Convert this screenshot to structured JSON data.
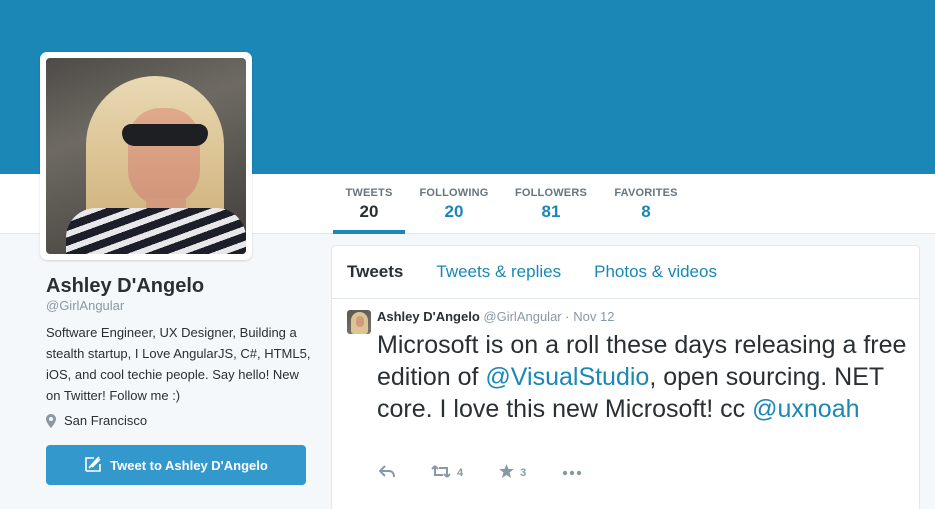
{
  "profile": {
    "name": "Ashley D'Angelo",
    "handle": "@GirlAngular",
    "bio": "Software Engineer, UX Designer, Building a stealth startup, I Love AngularJS, C#, HTML5, iOS, and cool techie people. Say hello! New on Twitter! Follow me :)",
    "location": "San Francisco",
    "tweet_to_label": "Tweet to Ashley D'Angelo"
  },
  "stats": [
    {
      "label": "TWEETS",
      "value": "20"
    },
    {
      "label": "FOLLOWING",
      "value": "20"
    },
    {
      "label": "FOLLOWERS",
      "value": "81"
    },
    {
      "label": "FAVORITES",
      "value": "8"
    }
  ],
  "timeline": {
    "tabs": [
      "Tweets",
      "Tweets & replies",
      "Photos & videos"
    ],
    "tweet": {
      "author": "Ashley D'Angelo",
      "handle": "@GirlAngular",
      "separator": "·",
      "date": "Nov 12",
      "text_1": "Microsoft is on a roll these days releasing a free edition of ",
      "mention_1": "@VisualStudio",
      "text_2": ",  open sourcing. NET core. I love this new Microsoft! cc ",
      "mention_2": "@uxnoah",
      "retweets": "4",
      "favorites": "3"
    }
  },
  "colors": {
    "banner": "#1a87b6",
    "accent": "#1a87b6",
    "button": "#3399cc"
  },
  "icons": [
    "reply-icon",
    "retweet-icon",
    "star-icon",
    "more-icon",
    "location-pin-icon",
    "compose-tweet-icon"
  ]
}
